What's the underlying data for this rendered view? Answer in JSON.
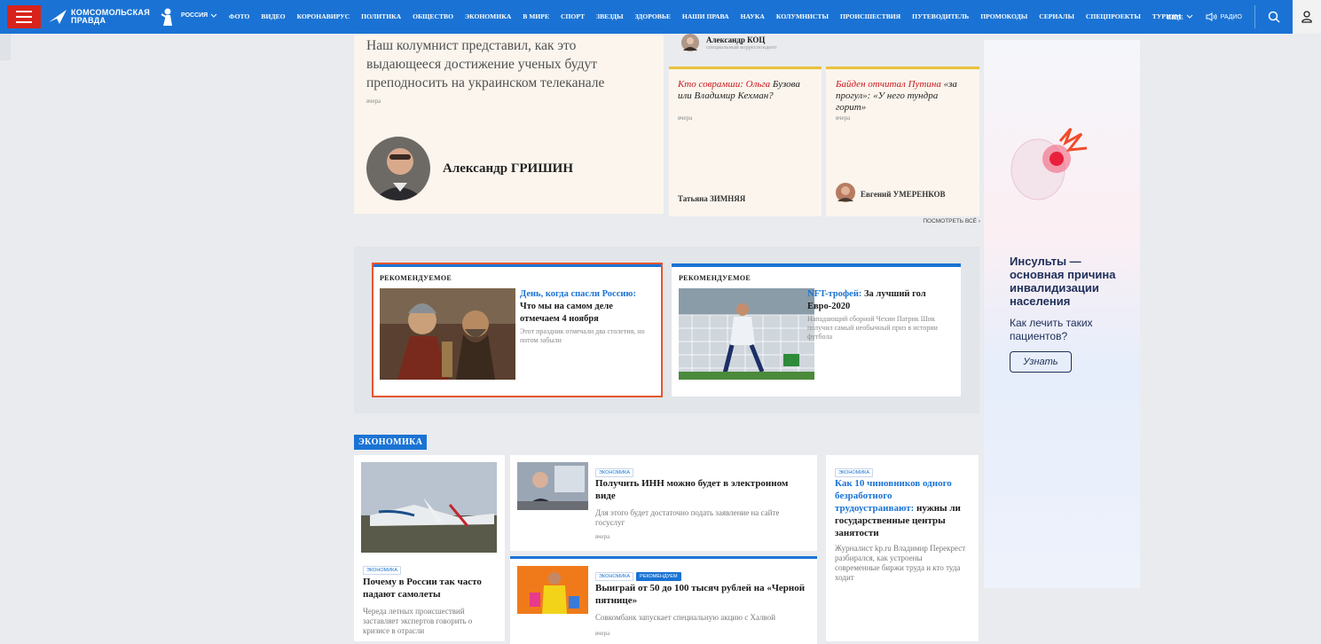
{
  "header": {
    "logo_text_line1": "КОМСОМОЛЬСКАЯ",
    "logo_text_line2": "ПРАВДА",
    "region": "РОССИЯ",
    "nav": [
      "ФОТО",
      "ВИДЕО",
      "КОРОНАВИРУС",
      "ПОЛИТИКА",
      "ОБЩЕСТВО",
      "ЭКОНОМИКА",
      "В МИРЕ",
      "СПОРТ",
      "ЗВЕЗДЫ",
      "ЗДОРОВЬЕ",
      "НАШИ ПРАВА",
      "НАУКА",
      "КОЛУМНИСТЫ",
      "ПРОИСШЕСТВИЯ",
      "ПУТЕВОДИТЕЛЬ",
      "ПРОМОКОДЫ",
      "СЕРИАЛЫ",
      "СПЕЦПРОЕКТЫ",
      "ТУРИЗМ"
    ],
    "more": "ЕЩЕ",
    "radio": "РАДИО",
    "colors": {
      "bar": "#1a73d4",
      "burger": "#d8231a"
    }
  },
  "columnists": {
    "lead": {
      "text": "Наш колумнист представил, как это выдающееся достижение ученых будут преподносить на украинском телеканале",
      "time": "вчера",
      "author": "Александр ГРИШИН"
    },
    "top_author": {
      "name": "Александр КОЦ",
      "role": "специальный корреспондент"
    },
    "card1": {
      "title_red": "Кто соврамши: Ольга",
      "title_rest": "Бузова или Владимир Кехман?",
      "time": "вчера",
      "author": "Татьяна ЗИМНЯЯ"
    },
    "card2": {
      "title_red": "Байден отчитал Путина",
      "title_rest": "«за прогул»: «У него тундра горит»",
      "time": "вчера",
      "author": "Евгений УМЕРЕНКОВ"
    },
    "see_all": "ПОСМОТРЕТЬ ВСЁ"
  },
  "recommended": [
    {
      "label": "РЕКОМЕНДУЕМОЕ",
      "title_blue": "День, когда спасли Россию:",
      "title_rest": "Что мы на самом деле отмечаем 4 ноября",
      "desc": "Этот праздник отмечали два столетия, но потом забыли"
    },
    {
      "label": "РЕКОМЕНДУЕМОЕ",
      "title_blue": "NFT-трофей:",
      "title_rest": "За лучший гол Евро-2020",
      "desc": "Нападающий сборной Чехии Патрик Шик получил самый необычный приз в истории футбола"
    }
  ],
  "economy": {
    "section": "ЭКОНОМИКА",
    "main": {
      "tag": "ЭКОНОМИКА",
      "title": "Почему в России так часто падают самолеты",
      "desc": "Череда летных происшествий заставляет экспертов говорить о кризисе в отрасли"
    },
    "item1": {
      "tag": "ЭКОНОМИКА",
      "title": "Получить ИНН можно будет в электронном виде",
      "desc": "Для этого будет достаточно подать заявление на сайте госуслуг",
      "time": "вчера"
    },
    "item2": {
      "tag": "ЭКОНОМИКА",
      "tag2": "РЕКОМЕНДУЕМ",
      "title": "Выиграй от 50 до 100 тысяч рублей на «Черной пятнице»",
      "desc": "Совкомбанк запускает специальную акцию с Халвой",
      "time": "вчера"
    },
    "item3": {
      "tag": "ЭКОНОМИКА",
      "title_blue": "Как 10 чиновников одного безработного трудоустраивают:",
      "title_rest": "нужны ли государственные центры занятости",
      "desc": "Журналист kp.ru Владимир Перекрест разбирался, как устроены современные биржи труда и кто туда ходит"
    }
  },
  "ad": {
    "title": "Инсульты — основная причина инвалидизации населения",
    "sub": "Как лечить таких пациентов?",
    "button": "Узнать"
  }
}
